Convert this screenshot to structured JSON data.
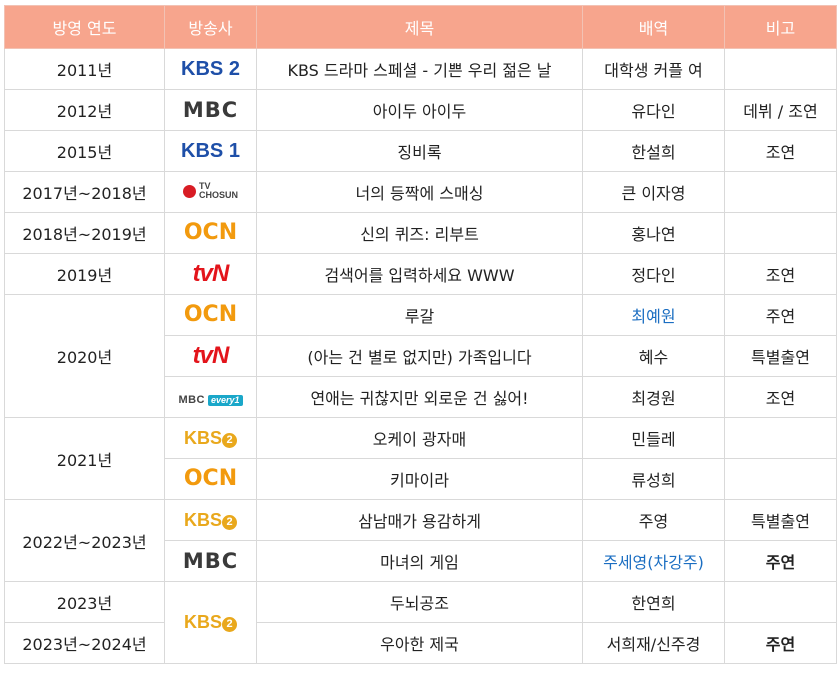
{
  "header": {
    "year": "방영 연도",
    "broadcaster": "방송사",
    "title": "제목",
    "role": "배역",
    "note": "비고"
  },
  "logos": {
    "kbs2": {
      "text": "KBS 2",
      "name": "kbs2-logo"
    },
    "kbs1": {
      "text": "KBS 1",
      "name": "kbs1-logo"
    },
    "kbs2y": {
      "text": "KBS",
      "circle": "2",
      "name": "kbs2-yellow-logo"
    },
    "mbc": {
      "text": "MBC",
      "name": "mbc-logo"
    },
    "ocn": {
      "text": "OCN",
      "name": "ocn-logo"
    },
    "tvn": {
      "text": "tvN",
      "name": "tvn-logo"
    },
    "tvchosun": {
      "line1": "TV",
      "line2": "CHOSUN",
      "name": "tv-chosun-logo"
    },
    "mbcevery": {
      "m": "MBC",
      "e": "every1",
      "name": "mbc-every1-logo"
    }
  },
  "rows": [
    {
      "year": "2011년",
      "title": "KBS 드라마 스페셜 - 기쁜 우리 젊은 날",
      "role": "대학생 커플 여",
      "note": ""
    },
    {
      "year": "2012년",
      "title": "아이두 아이두",
      "role": "유다인",
      "note": "데뷔 / 조연"
    },
    {
      "year": "2015년",
      "title": "징비록",
      "role": "한설희",
      "note": "조연"
    },
    {
      "year": "2017년~2018년",
      "title": "너의 등짝에 스매싱",
      "role": "큰 이자영",
      "note": ""
    },
    {
      "year": "2018년~2019년",
      "title": "신의 퀴즈: 리부트",
      "role": "홍나연",
      "note": ""
    },
    {
      "year": "2019년",
      "title": "검색어를 입력하세요 WWW",
      "role": "정다인",
      "note": "조연"
    },
    {
      "year": "2020년",
      "title": "루갈",
      "role": "최예원",
      "note": "주연"
    },
    {
      "year": "",
      "title": "(아는 건 별로 없지만) 가족입니다",
      "role": "혜수",
      "note": "특별출연"
    },
    {
      "year": "",
      "title": "연애는 귀찮지만 외로운 건 싫어!",
      "role": "최경원",
      "note": "조연"
    },
    {
      "year": "2021년",
      "title": "오케이 광자매",
      "role": "민들레",
      "note": ""
    },
    {
      "year": "",
      "title": "키마이라",
      "role": "류성희",
      "note": ""
    },
    {
      "year": "2022년~2023년",
      "title": "삼남매가 용감하게",
      "role": "주영",
      "note": "특별출연"
    },
    {
      "year": "",
      "title": "마녀의 게임",
      "role": "주세영(차강주)",
      "note": "주연"
    },
    {
      "year": "2023년",
      "title": "두뇌공조",
      "role": "한연희",
      "note": ""
    },
    {
      "year": "2023년~2024년",
      "title": "우아한 제국",
      "role": "서희재/신주경",
      "note": "주연"
    }
  ]
}
